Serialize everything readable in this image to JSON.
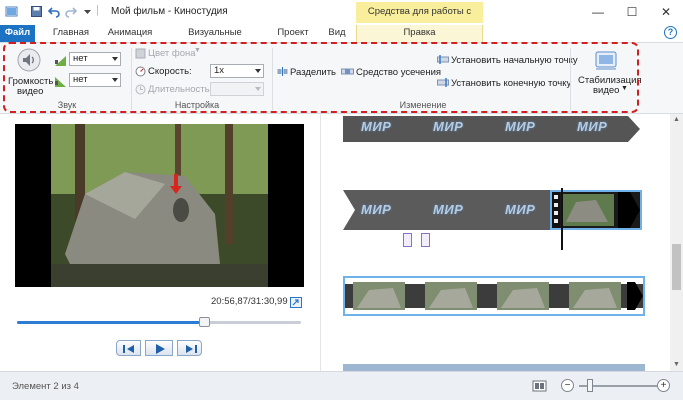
{
  "window": {
    "title": "Мой фильм - Киностудия",
    "context_tab_group": "Средства для работы с видео",
    "controls": {
      "minimize": "—",
      "maximize": "☐",
      "close": "✕"
    }
  },
  "tabs": [
    {
      "label": "Файл",
      "active": true
    },
    {
      "label": "Главная"
    },
    {
      "label": "Анимация"
    },
    {
      "label": "Визуальные эффекты"
    },
    {
      "label": "Проект"
    },
    {
      "label": "Вид"
    },
    {
      "label": "Правка",
      "contextual": true
    }
  ],
  "help_label": "?",
  "ribbon": {
    "sound": {
      "group_label": "Звук",
      "volume_label_line1": "Громкость",
      "volume_label_line2": "видео",
      "fade_in_value": "нет",
      "fade_out_value": "нет"
    },
    "settings": {
      "group_label": "Настройка",
      "bg_color_label": "Цвет фона",
      "speed_label": "Скорость:",
      "speed_value": "1x",
      "duration_label": "Длительность:",
      "duration_value": ""
    },
    "edit": {
      "group_label": "Изменение",
      "split_label": "Разделить",
      "trim_label": "Средство усечения",
      "set_start_label": "Установить начальную точку",
      "set_end_label": "Установить конечную точку"
    },
    "stabilization": {
      "label_line1": "Стабилизация",
      "label_line2": "видео"
    }
  },
  "preview": {
    "time": "20:56,87/31:30,99",
    "seek_progress_percent": 66
  },
  "storyboard": {
    "title_word": "МИР"
  },
  "statusbar": {
    "text": "Элемент 2 из 4",
    "zoom_minus": "−",
    "zoom_plus": "+"
  },
  "colors": {
    "accent": "#1c73c3",
    "context_tab": "#f8ee9c",
    "highlight": "#d21f1f"
  }
}
